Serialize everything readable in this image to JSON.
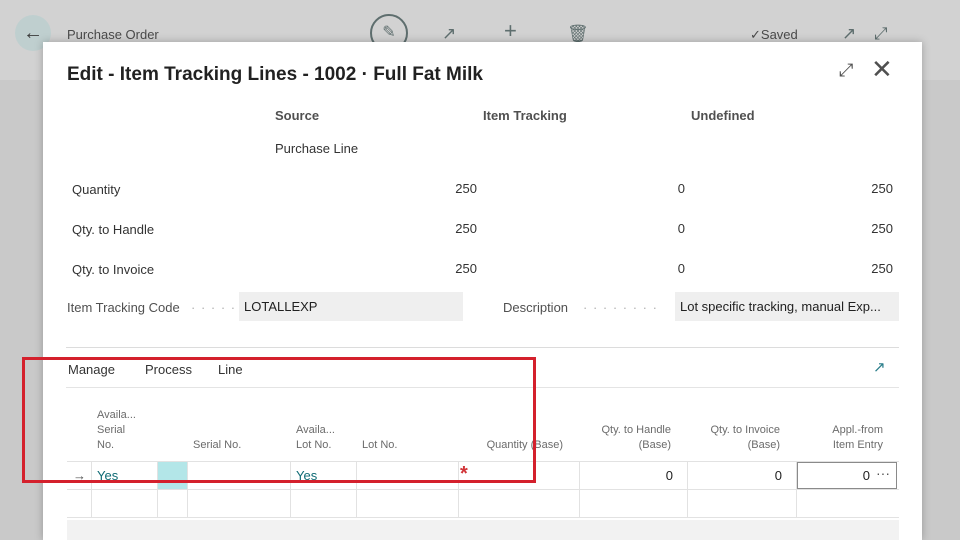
{
  "background": {
    "page_title": "Purchase Order",
    "saved_label": "Saved",
    "icons": [
      "back-arrow-icon",
      "pencil-icon",
      "share-icon",
      "plus-icon",
      "trash-icon",
      "checkmark-icon",
      "open-new-icon",
      "expand-icon"
    ]
  },
  "dialog": {
    "title": "Edit - Item Tracking Lines - 1002 · Full Fat Milk",
    "summary": {
      "columns": [
        "Source",
        "Item Tracking",
        "Undefined"
      ],
      "source_sub": "Purchase Line",
      "rows": [
        {
          "label": "Quantity",
          "source": "250",
          "item_tracking": "0",
          "undefined": "250"
        },
        {
          "label": "Qty. to Handle",
          "source": "250",
          "item_tracking": "0",
          "undefined": "250"
        },
        {
          "label": "Qty. to Invoice",
          "source": "250",
          "item_tracking": "0",
          "undefined": "250"
        }
      ]
    },
    "item_tracking_code": {
      "label": "Item Tracking Code",
      "value": "LOTALLEXP"
    },
    "description": {
      "label": "Description",
      "value": "Lot specific tracking, manual Exp..."
    },
    "actions": [
      "Manage",
      "Process",
      "Line"
    ],
    "grid": {
      "headers": {
        "avail_serial": [
          "Availa...",
          "Serial",
          "No."
        ],
        "serial_no": "Serial No.",
        "avail_lot": [
          "Availa...",
          "Lot No."
        ],
        "lot_no": "Lot No.",
        "quantity_base": "Quantity (Base)",
        "qty_handle": [
          "Qty. to Handle",
          "(Base)"
        ],
        "qty_invoice": [
          "Qty. to Invoice",
          "(Base)"
        ],
        "appl_from": [
          "Appl.-from",
          "Item Entry"
        ]
      },
      "row": {
        "marker": "→",
        "avail_serial": "Yes",
        "avail_lot": "Yes",
        "required_marker": "*",
        "qty_handle": "0",
        "qty_invoice": "0",
        "appl_from": "0",
        "more": "···"
      }
    }
  },
  "colors": {
    "accent": "#0f6b75",
    "required": "#d13438",
    "highlight": "#d4202c",
    "selected_cell": "#b3e6e8"
  }
}
